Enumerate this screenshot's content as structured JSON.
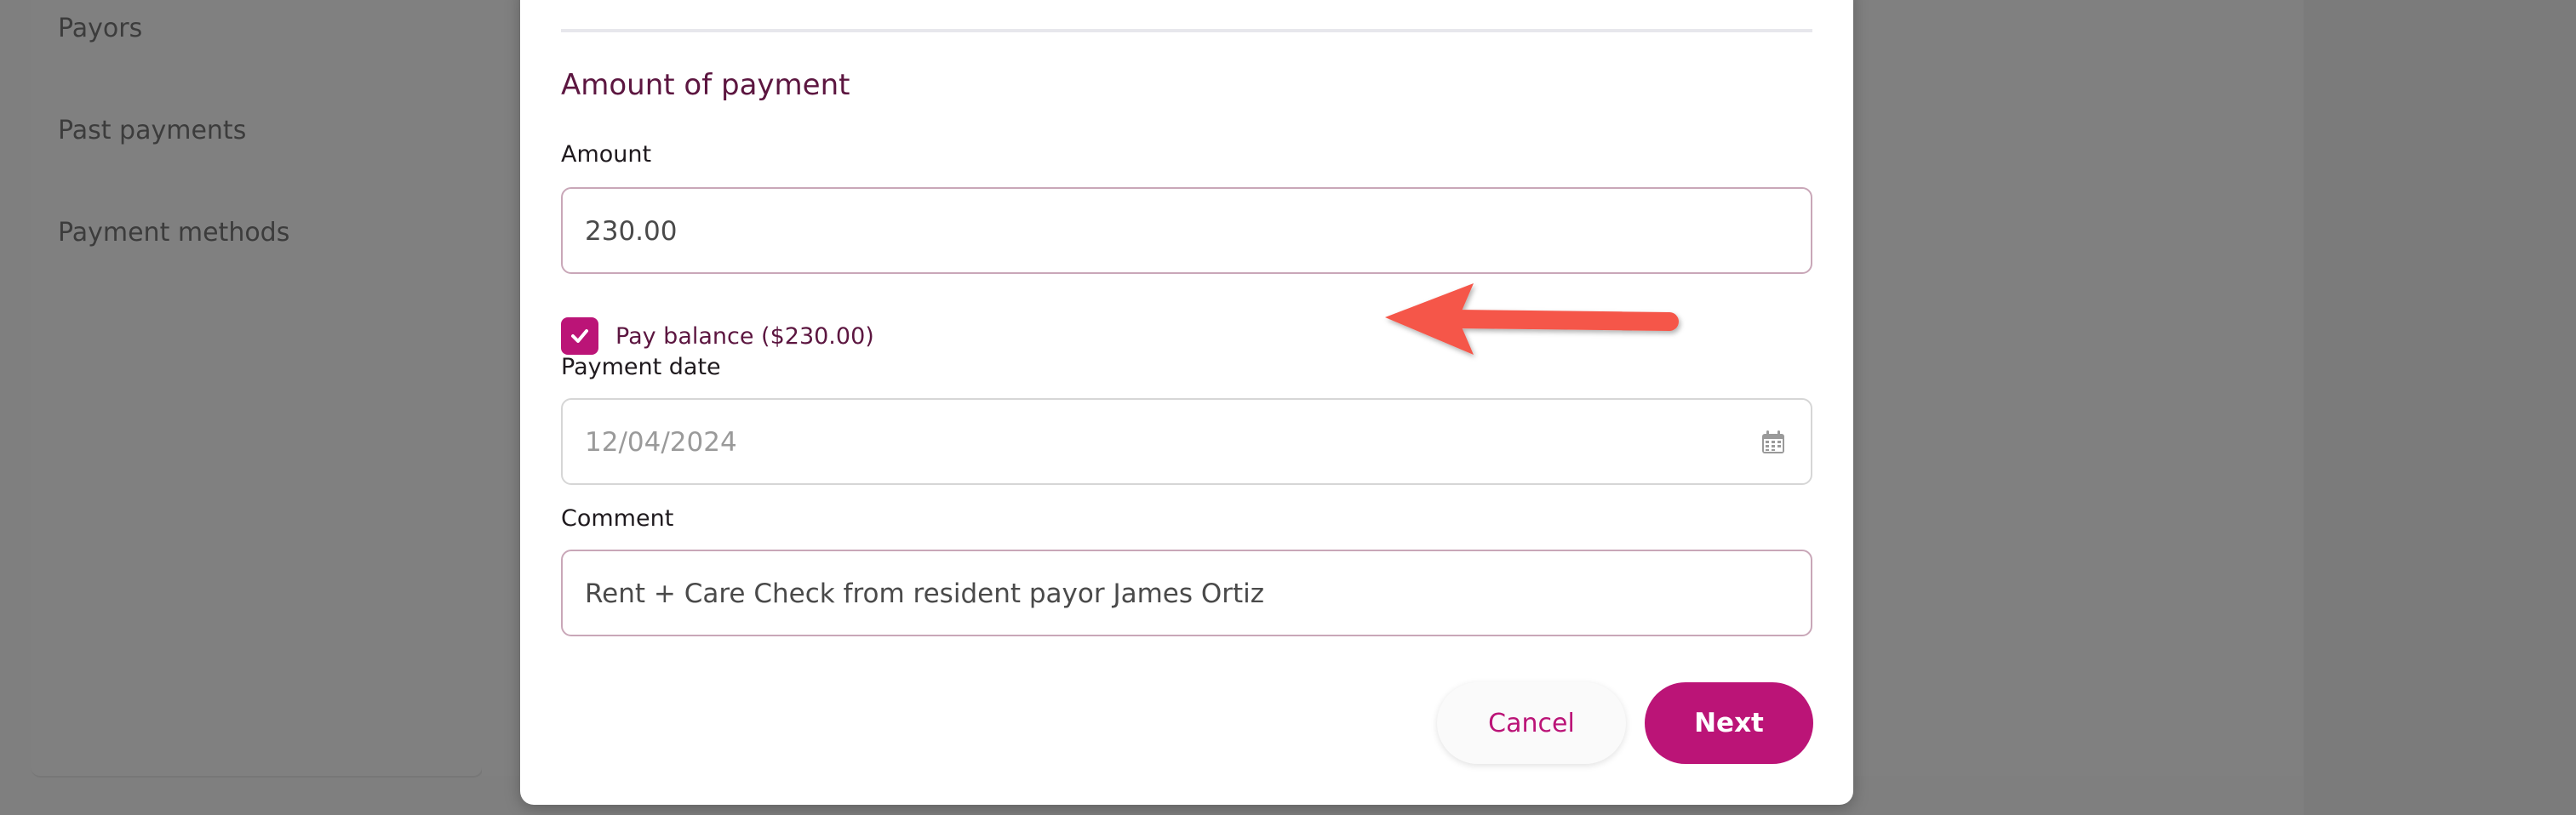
{
  "sidebar": {
    "items": [
      {
        "label": "Payors"
      },
      {
        "label": "Past payments"
      },
      {
        "label": "Payment methods"
      }
    ]
  },
  "modal": {
    "section_title": "Amount of payment",
    "amount": {
      "label": "Amount",
      "value": "230.00"
    },
    "pay_balance": {
      "label": "Pay balance ($230.00)",
      "checked": true
    },
    "payment_date": {
      "label": "Payment date",
      "value": "12/04/2024",
      "icon": "calendar-icon"
    },
    "comment": {
      "label": "Comment",
      "value": "Rent + Care Check from resident payor James Ortiz"
    },
    "buttons": {
      "cancel": "Cancel",
      "next": "Next"
    }
  },
  "colors": {
    "accent": "#bb1477",
    "title": "#5c1640",
    "annotation_arrow": "#f5574a",
    "overlay": "#7f7f7f"
  }
}
